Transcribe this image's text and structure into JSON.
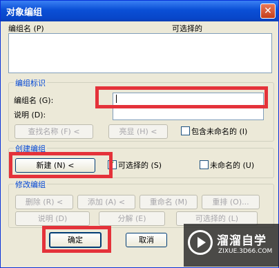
{
  "window": {
    "title": "对象编组",
    "close_glyph": "✕"
  },
  "list": {
    "col_name": "编组名 (P)",
    "col_selectable": "可选择的"
  },
  "id_group": {
    "title": "编组标识",
    "name_label": "编组名 (G):",
    "name_value": "",
    "desc_label": "说明 (D):",
    "desc_value": "",
    "find_btn": "查找名称 (F) <",
    "highlight_btn": "亮显 (H) <",
    "include_unnamed": "包含未命名的 (I)"
  },
  "create_group": {
    "title": "创建编组",
    "new_btn": "新建 (N) <",
    "selectable_label": "可选择的 (S)",
    "selectable_checked": true,
    "unnamed_label": "未命名的 (U)"
  },
  "modify_group": {
    "title": "修改编组",
    "remove_btn": "删除 (R) <",
    "add_btn": "添加 (A) <",
    "rename_btn": "重命名 (M)",
    "reorder_btn": "重排 (O)...",
    "desc_btn": "说明 (D)",
    "explode_btn": "分解 (E)",
    "selectable_btn": "可选择的 (L)"
  },
  "footer": {
    "ok": "确定",
    "cancel": "取消"
  },
  "watermark": {
    "name": "溜溜自学",
    "url": "ZIXUE.3D66.COM"
  },
  "colors": {
    "titlebar": "#0a4fd6",
    "highlight": "#e4323a",
    "group_title": "#0046d5"
  }
}
